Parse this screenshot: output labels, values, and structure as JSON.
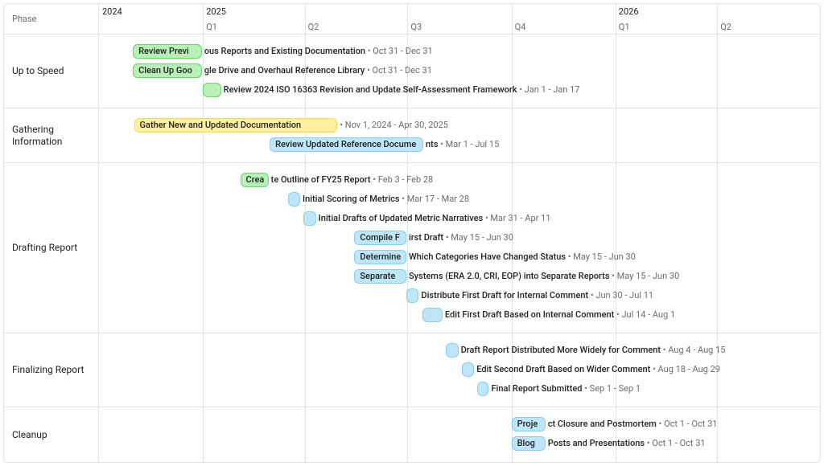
{
  "header": {
    "phase_label": "Phase"
  },
  "timeline": {
    "start": "2024-10-01",
    "end": "2026-07-01",
    "years": [
      {
        "label": "2024",
        "at": "2024-10-01"
      },
      {
        "label": "2025",
        "at": "2025-01-01"
      },
      {
        "label": "2026",
        "at": "2026-01-01"
      }
    ],
    "quarters": [
      {
        "label": "Q1",
        "at": "2025-01-01"
      },
      {
        "label": "Q2",
        "at": "2025-04-01"
      },
      {
        "label": "Q3",
        "at": "2025-07-01"
      },
      {
        "label": "Q4",
        "at": "2025-10-01"
      },
      {
        "label": "Q1",
        "at": "2026-01-01"
      },
      {
        "label": "Q2",
        "at": "2026-04-01"
      }
    ],
    "gridlines": [
      "2025-01-01",
      "2025-04-01",
      "2025-07-01",
      "2025-10-01",
      "2026-01-01",
      "2026-04-01"
    ]
  },
  "phases": [
    {
      "name": "Up to Speed",
      "tasks": [
        {
          "label": "Review Previous Reports and Existing Documentation",
          "start": "2024-10-31",
          "end": "2024-12-31",
          "dates": "Oct 31 - Dec 31",
          "color": "green"
        },
        {
          "label": "Clean Up Google Drive and Overhaul Reference Library",
          "start": "2024-10-31",
          "end": "2024-12-31",
          "dates": "Oct 31 - Dec 31",
          "color": "green"
        },
        {
          "label": "Review 2024 ISO 16363 Revision and Update Self-Assessment Framework",
          "start": "2025-01-01",
          "end": "2025-01-17",
          "dates": "Jan 1 - Jan 17",
          "color": "green"
        }
      ]
    },
    {
      "name": "Gathering Information",
      "tasks": [
        {
          "label": "Gather New and Updated Documentation",
          "start": "2024-11-01",
          "end": "2025-04-30",
          "dates": "Nov 1, 2024 - Apr 30, 2025",
          "color": "yellow"
        },
        {
          "label": "Review Updated Reference Documents",
          "start": "2025-03-01",
          "end": "2025-07-15",
          "dates": "Mar 1 - Jul 15",
          "color": "blue"
        }
      ]
    },
    {
      "name": "Drafting Report",
      "tasks": [
        {
          "label": "Create Outline of FY25 Report",
          "start": "2025-02-03",
          "end": "2025-02-28",
          "dates": "Feb 3 - Feb 28",
          "color": "green"
        },
        {
          "label": "Initial Scoring of Metrics",
          "start": "2025-03-17",
          "end": "2025-03-28",
          "dates": "Mar 17 - Mar 28",
          "color": "blue"
        },
        {
          "label": "Initial Drafts of Updated Metric Narratives",
          "start": "2025-03-31",
          "end": "2025-04-11",
          "dates": "Mar 31 - Apr 11",
          "color": "blue"
        },
        {
          "label": "Compile First Draft",
          "start": "2025-05-15",
          "end": "2025-06-30",
          "dates": "May 15 - Jun 30",
          "color": "blue"
        },
        {
          "label": "Determine Which Categories Have Changed Status",
          "start": "2025-05-15",
          "end": "2025-06-30",
          "dates": "May 15 - Jun 30",
          "color": "blue"
        },
        {
          "label": "Separate Systems (ERA 2.0, CRI, EOP) into Separate Reports",
          "start": "2025-05-15",
          "end": "2025-06-30",
          "dates": "May 15 - Jun 30",
          "color": "blue"
        },
        {
          "label": "Distribute First Draft for Internal Comment",
          "start": "2025-06-30",
          "end": "2025-07-11",
          "dates": "Jun 30 - Jul 11",
          "color": "blue"
        },
        {
          "label": "Edit First Draft Based on Internal Comment",
          "start": "2025-07-14",
          "end": "2025-08-01",
          "dates": "Jul 14 - Aug 1",
          "color": "blue"
        }
      ]
    },
    {
      "name": "Finalizing Report",
      "tasks": [
        {
          "label": "Draft Report Distributed More Widely for Comment",
          "start": "2025-08-04",
          "end": "2025-08-15",
          "dates": "Aug 4 - Aug 15",
          "color": "blue"
        },
        {
          "label": "Edit Second Draft Based on Wider Comment",
          "start": "2025-08-18",
          "end": "2025-08-29",
          "dates": "Aug 18 - Aug 29",
          "color": "blue"
        },
        {
          "label": "Final Report Submitted",
          "start": "2025-09-01",
          "end": "2025-09-01",
          "dates": "Sep 1 - Sep 1",
          "color": "blue"
        }
      ]
    },
    {
      "name": "Cleanup",
      "tasks": [
        {
          "label": "Project Closure and Postmortem",
          "start": "2025-10-01",
          "end": "2025-10-31",
          "dates": "Oct 1 - Oct 31",
          "color": "blue"
        },
        {
          "label": "Blog Posts and Presentations",
          "start": "2025-10-01",
          "end": "2025-10-31",
          "dates": "Oct 1 - Oct 31",
          "color": "blue"
        }
      ]
    }
  ],
  "chart_data": {
    "type": "gantt",
    "title": "",
    "x_axis": {
      "start": "2024-10-01",
      "end": "2026-07-01",
      "tick_unit": "quarter"
    },
    "categories": [
      "Up to Speed",
      "Gathering Information",
      "Drafting Report",
      "Finalizing Report",
      "Cleanup"
    ],
    "status_colors": {
      "green": "#b7efb7",
      "yellow": "#fff0a0",
      "blue": "#bfe5f8"
    },
    "series": [
      {
        "phase": "Up to Speed",
        "name": "Review Previous Reports and Existing Documentation",
        "start": "2024-10-31",
        "end": "2024-12-31",
        "status": "green"
      },
      {
        "phase": "Up to Speed",
        "name": "Clean Up Google Drive and Overhaul Reference Library",
        "start": "2024-10-31",
        "end": "2024-12-31",
        "status": "green"
      },
      {
        "phase": "Up to Speed",
        "name": "Review 2024 ISO 16363 Revision and Update Self-Assessment Framework",
        "start": "2025-01-01",
        "end": "2025-01-17",
        "status": "green"
      },
      {
        "phase": "Gathering Information",
        "name": "Gather New and Updated Documentation",
        "start": "2024-11-01",
        "end": "2025-04-30",
        "status": "yellow"
      },
      {
        "phase": "Gathering Information",
        "name": "Review Updated Reference Documents",
        "start": "2025-03-01",
        "end": "2025-07-15",
        "status": "blue"
      },
      {
        "phase": "Drafting Report",
        "name": "Create Outline of FY25 Report",
        "start": "2025-02-03",
        "end": "2025-02-28",
        "status": "green"
      },
      {
        "phase": "Drafting Report",
        "name": "Initial Scoring of Metrics",
        "start": "2025-03-17",
        "end": "2025-03-28",
        "status": "blue"
      },
      {
        "phase": "Drafting Report",
        "name": "Initial Drafts of Updated Metric Narratives",
        "start": "2025-03-31",
        "end": "2025-04-11",
        "status": "blue"
      },
      {
        "phase": "Drafting Report",
        "name": "Compile First Draft",
        "start": "2025-05-15",
        "end": "2025-06-30",
        "status": "blue"
      },
      {
        "phase": "Drafting Report",
        "name": "Determine Which Categories Have Changed Status",
        "start": "2025-05-15",
        "end": "2025-06-30",
        "status": "blue"
      },
      {
        "phase": "Drafting Report",
        "name": "Separate Systems (ERA 2.0, CRI, EOP) into Separate Reports",
        "start": "2025-05-15",
        "end": "2025-06-30",
        "status": "blue"
      },
      {
        "phase": "Drafting Report",
        "name": "Distribute First Draft for Internal Comment",
        "start": "2025-06-30",
        "end": "2025-07-11",
        "status": "blue"
      },
      {
        "phase": "Drafting Report",
        "name": "Edit First Draft Based on Internal Comment",
        "start": "2025-07-14",
        "end": "2025-08-01",
        "status": "blue"
      },
      {
        "phase": "Finalizing Report",
        "name": "Draft Report Distributed More Widely for Comment",
        "start": "2025-08-04",
        "end": "2025-08-15",
        "status": "blue"
      },
      {
        "phase": "Finalizing Report",
        "name": "Edit Second Draft Based on Wider Comment",
        "start": "2025-08-18",
        "end": "2025-08-29",
        "status": "blue"
      },
      {
        "phase": "Finalizing Report",
        "name": "Final Report Submitted",
        "start": "2025-09-01",
        "end": "2025-09-01",
        "status": "blue"
      },
      {
        "phase": "Cleanup",
        "name": "Project Closure and Postmortem",
        "start": "2025-10-01",
        "end": "2025-10-31",
        "status": "blue"
      },
      {
        "phase": "Cleanup",
        "name": "Blog Posts and Presentations",
        "start": "2025-10-01",
        "end": "2025-10-31",
        "status": "blue"
      }
    ]
  }
}
